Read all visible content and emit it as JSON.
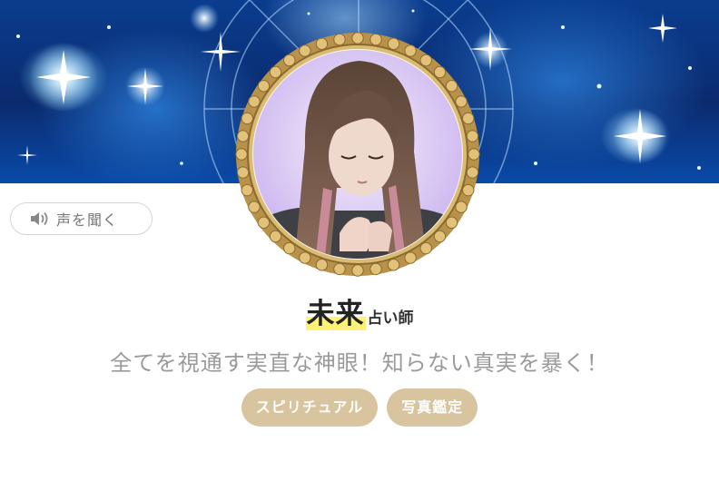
{
  "profile": {
    "voice_button_label": "声を聞く",
    "name": "未来",
    "role": "占い師",
    "catchphrase": "全てを視通す実直な神眼！知らない真実を暴く！",
    "tags": [
      "スピリチュアル",
      "写真鑑定"
    ]
  },
  "icons": {
    "voice": "speaker-icon"
  },
  "colors": {
    "banner": "#0b2a6e",
    "frame_gold": "#c9a55a",
    "photo_bg": "#e4d6f5",
    "name_highlight": "#fff176",
    "tag_bg": "#d8c49e",
    "catch_text": "#9a9a9a",
    "voice_text": "#777777"
  }
}
